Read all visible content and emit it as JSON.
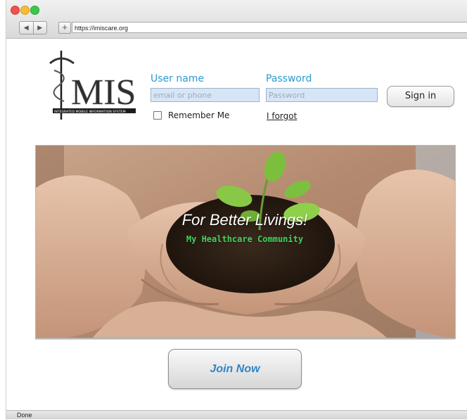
{
  "browser": {
    "url": "https://imiscare.org",
    "back_glyph": "◀",
    "forward_glyph": "▶",
    "new_tab_glyph": "+",
    "status": "Done"
  },
  "logo": {
    "wordmark": "MIS",
    "tagline": "INTEGRATED MOBILE INFORMATION SYSTEM"
  },
  "login": {
    "username_label": "User name",
    "username_placeholder": "email or phone",
    "password_label": "Password",
    "password_placeholder": "Password",
    "signin_label": "Sign in",
    "remember_label": "Remember Me",
    "forgot_label": "I forgot"
  },
  "hero": {
    "tagline": "For Better Livings!",
    "subtagline": "My Healthcare Community"
  },
  "cta": {
    "join_label": "Join Now"
  },
  "colors": {
    "label_blue": "#2a9bd1",
    "join_text": "#2f86c6",
    "sub_tagline_green": "#41d35d",
    "input_fill": "#d6e6f6"
  }
}
